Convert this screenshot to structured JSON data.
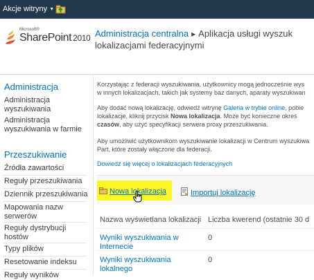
{
  "topbar": {
    "site_actions": "Akcje witryny"
  },
  "logo": {
    "microsoft": "Microsoft®",
    "brand": "SharePoint",
    "version": "2010"
  },
  "header": {
    "crumb_link": "Administracja centralna",
    "crumb_sep": "▸",
    "crumb_rest": "Aplikacja usługi wyszuk",
    "title_line2": "lokalizacjami federacyjnymi"
  },
  "sidebar": {
    "admin_heading": "Administracja",
    "admin_items": [
      "Administracja wyszukiwania",
      "Administracja wyszukiwania w farmie"
    ],
    "crawl_heading": "Przeszukiwanie",
    "crawl_items": [
      "Źródła zawartości",
      "Reguły przeszukiwania",
      "Dziennik przeszukiwania",
      "Mapowania nazw serwerów",
      "Reguły dystrybucji hostów",
      "Typy plików",
      "Resetowanie indeksu",
      "Reguły wyników"
    ]
  },
  "content": {
    "para1_line1": "Korzystając z federacji wyszukiwania, użytkownicy mogą jednocześnie wys",
    "para1_line2": "w innych lokalizacjach, takich jak systemy baz danych, aparaty wyszukiwan",
    "para2_line1_a": "Aby dodać nową lokalizację, odwiedź witrynę ",
    "para2_link": "Galeria w trybie online",
    "para2_line1_b": ", pobie",
    "para2_line2_a": "lokalizacje, kliknij przycisk ",
    "para2_bold1": "Nowa lokalizacja",
    "para2_line2_b": ". Może być konieczne okreś",
    "para2_bold2": "czasów",
    "para2_line3_b": ", aby użyć specyfikacji serwera proxy przeszukiwania.",
    "para3_line1": "Aby umożliwić użytkownikom wyszukiwanie lokalizacji w Centrum wyszukiwa",
    "para3_line2": "Part, które zostały włączone dla federacji.",
    "learn_more": "Dowiedz się więcej o lokalizacjach federacyjnych"
  },
  "toolbar": {
    "new_location": "Nowa lokalizacja",
    "import_location": "Importuj lokalizację",
    "highlight_color": "#fbf625"
  },
  "table": {
    "headers": [
      "Nazwa wyświetlana lokalizacji",
      "Liczba kwerend (ostatnie 30 d"
    ],
    "rows": [
      {
        "name_line1": "Wyniki wyszukiwania w",
        "name_line2": "Internecie",
        "count": "0"
      },
      {
        "name_line1": "Wyniki wyszukiwania",
        "name_line2": "lokalnego",
        "count": "0"
      }
    ]
  },
  "colors": {
    "topbar": "#21374c",
    "link": "#0072bc",
    "text": "#4c4c4c"
  }
}
